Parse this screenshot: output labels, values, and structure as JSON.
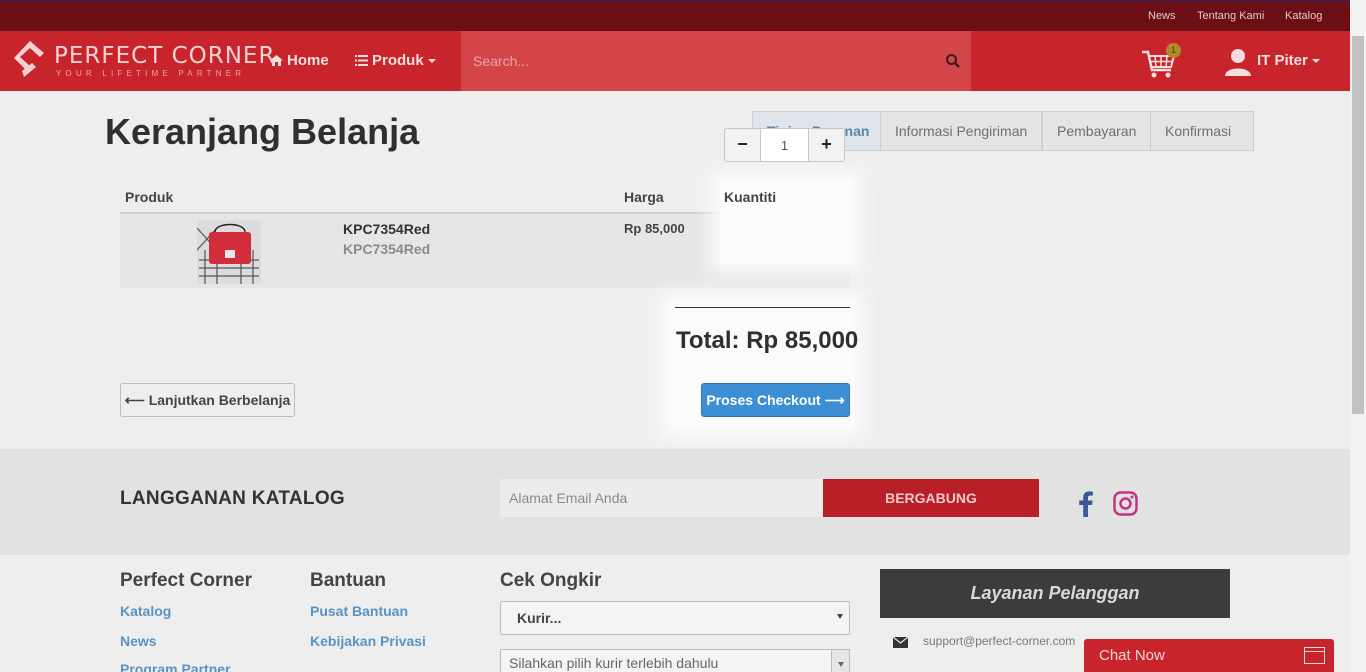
{
  "topbar": {
    "links": [
      "News",
      "Tentang Kami",
      "Katalog"
    ]
  },
  "navbar": {
    "logo_name": "PERFECT CORNER",
    "logo_tagline": "YOUR LIFETIME PARTNER",
    "home_label": "Home",
    "produk_label": "Produk",
    "search_placeholder": "Search...",
    "cart_count": "1",
    "user_name": "IT Piter"
  },
  "page": {
    "title": "Keranjang Belanja",
    "steps": [
      "Tinjau Pesanan",
      "Informasi Pengiriman",
      "Pembayaran",
      "Konfirmasi"
    ],
    "active_step": "Tinjau Pesanan"
  },
  "cart_table": {
    "headers": {
      "produk": "Produk",
      "harga": "Harga",
      "kuantiti": "Kuantiti"
    },
    "items": [
      {
        "name": "KPC7354Red",
        "sku": "KPC7354Red",
        "price": "Rp 85,000",
        "quantity": "1"
      }
    ]
  },
  "summary": {
    "total": "Total: Rp 85,000",
    "back_label": "Lanjutkan Berbelanja",
    "checkout_label": "Proses Checkout"
  },
  "subscribe": {
    "title": "LANGGANAN KATALOG",
    "email_placeholder": "Alamat Email Anda",
    "button_label": "BERGABUNG"
  },
  "footer": {
    "col1_title": "Perfect Corner",
    "col1_links": [
      "Katalog",
      "News",
      "Program Partner"
    ],
    "col2_title": "Bantuan",
    "col2_links": [
      "Pusat Bantuan",
      "Kebijakan Privasi"
    ],
    "col3_title": "Cek Ongkir",
    "courier_select": "Kurir...",
    "service_select": "Silahkan pilih kurir terlebih dahulu",
    "cs_title": "Layanan Pelanggan",
    "cs_email": "support@perfect-corner.com"
  },
  "chat": {
    "label": "Chat Now"
  },
  "colors": {
    "brand_red": "#c8242b",
    "topbar_dark_red": "#6b0f14",
    "checkout_blue": "#3d8fd4",
    "link_blue": "#5b93c2"
  }
}
